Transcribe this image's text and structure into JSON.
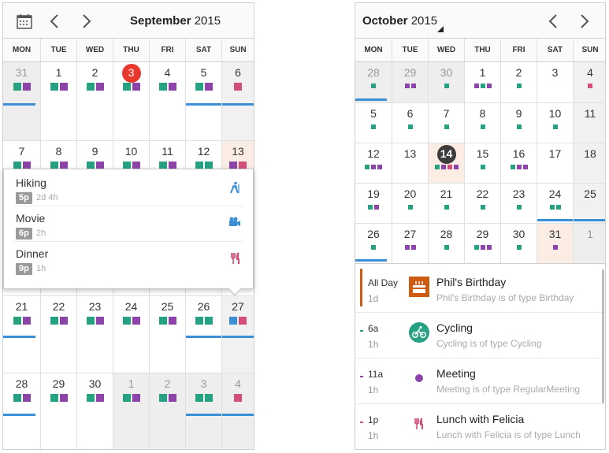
{
  "colors": {
    "teal": "#26a182",
    "purple": "#8c44a8",
    "pink": "#d14f78",
    "blue": "#3a8fd6",
    "red": "#e8372c",
    "orange": "#cf5b13"
  },
  "left": {
    "month": "September",
    "year": "2015",
    "weekdays": [
      "MON",
      "TUE",
      "WED",
      "THU",
      "FRI",
      "SAT",
      "SUN"
    ],
    "weeks": [
      [
        {
          "d": "31",
          "other": true,
          "dots": [
            "#26a182",
            "#8c44a8"
          ],
          "bar": true
        },
        {
          "d": "1",
          "dots": [
            "#26a182",
            "#8c44a8"
          ]
        },
        {
          "d": "2",
          "dots": [
            "#26a182",
            "#8c44a8"
          ]
        },
        {
          "d": "3",
          "today": true,
          "dots": [
            "#26a182",
            "#8c44a8"
          ]
        },
        {
          "d": "4",
          "dots": [
            "#26a182",
            "#8c44a8"
          ]
        },
        {
          "d": "5",
          "dots": [
            "#26a182",
            "#8c44a8"
          ],
          "bar": true
        },
        {
          "d": "6",
          "wknd": true,
          "dots": [
            "#d14f78"
          ],
          "bar": true
        }
      ],
      [
        {
          "d": "7",
          "dots": [
            "#26a182",
            "#8c44a8"
          ]
        },
        {
          "d": "8",
          "dots": [
            "#26a182",
            "#8c44a8"
          ]
        },
        {
          "d": "9",
          "dots": [
            "#26a182",
            "#8c44a8"
          ]
        },
        {
          "d": "10",
          "dots": [
            "#26a182",
            "#8c44a8"
          ]
        },
        {
          "d": "11",
          "dots": [
            "#26a182",
            "#8c44a8"
          ]
        },
        {
          "d": "12",
          "dots": [
            "#26a182",
            "#26a182"
          ]
        },
        {
          "d": "13",
          "hl": true,
          "dots": [
            "#8c44a8",
            "#d14f78"
          ]
        }
      ],
      [
        {
          "d": ""
        },
        {
          "d": ""
        },
        {
          "d": ""
        },
        {
          "d": ""
        },
        {
          "d": ""
        },
        {
          "d": ""
        },
        {
          "d": ""
        }
      ],
      [
        {
          "d": "21",
          "dots": [
            "#26a182",
            "#8c44a8"
          ],
          "bar": true
        },
        {
          "d": "22",
          "dots": [
            "#26a182",
            "#8c44a8"
          ]
        },
        {
          "d": "23",
          "dots": [
            "#26a182",
            "#8c44a8"
          ]
        },
        {
          "d": "24",
          "dots": [
            "#26a182",
            "#8c44a8"
          ]
        },
        {
          "d": "25",
          "dots": [
            "#26a182",
            "#8c44a8"
          ]
        },
        {
          "d": "26",
          "dots": [
            "#26a182",
            "#26a182"
          ],
          "bar": true
        },
        {
          "d": "27",
          "wknd": true,
          "dots": [
            "#3a8fd6",
            "#d14f78"
          ],
          "bar": true
        }
      ],
      [
        {
          "d": "28",
          "dots": [
            "#26a182",
            "#8c44a8"
          ],
          "bar": true
        },
        {
          "d": "29",
          "dots": [
            "#26a182",
            "#8c44a8"
          ]
        },
        {
          "d": "30",
          "dots": [
            "#26a182",
            "#8c44a8"
          ]
        },
        {
          "d": "1",
          "other": true,
          "dots": [
            "#26a182",
            "#8c44a8"
          ]
        },
        {
          "d": "2",
          "other": true,
          "dots": [
            "#26a182",
            "#8c44a8"
          ]
        },
        {
          "d": "3",
          "other": true,
          "dots": [
            "#26a182",
            "#26a182"
          ],
          "bar": true
        },
        {
          "d": "4",
          "other": true,
          "dots": [
            "#d14f78"
          ],
          "bar": true
        }
      ]
    ],
    "popup": [
      {
        "title": "Hiking",
        "time": "5p",
        "duration": "2d 4h",
        "icon": "hiking-icon",
        "color": "#3a8fd6"
      },
      {
        "title": "Movie",
        "time": "6p",
        "duration": "2h",
        "icon": "video-camera-icon",
        "color": "#3a8fd6"
      },
      {
        "title": "Dinner",
        "time": "9p",
        "duration": "1h",
        "icon": "fork-knife-icon",
        "color": "#d14f78"
      }
    ]
  },
  "right": {
    "month": "October",
    "year": "2015",
    "weekdays": [
      "MON",
      "TUE",
      "WED",
      "THU",
      "FRI",
      "SAT",
      "SUN"
    ],
    "weeks": [
      [
        {
          "d": "28",
          "other": true,
          "dots": [
            "#26a182"
          ],
          "bar": true
        },
        {
          "d": "29",
          "other": true,
          "dots": [
            "#8c44a8",
            "#8c44a8"
          ]
        },
        {
          "d": "30",
          "other": true,
          "dots": [
            "#26a182"
          ]
        },
        {
          "d": "1",
          "dots": [
            "#8c44a8",
            "#26a182",
            "#8c44a8"
          ]
        },
        {
          "d": "2",
          "dots": [
            "#26a182"
          ]
        },
        {
          "d": "3",
          "dots": []
        },
        {
          "d": "4",
          "wknd": true,
          "dots": [
            "#d14f78"
          ]
        }
      ],
      [
        {
          "d": "5",
          "dots": [
            "#26a182"
          ]
        },
        {
          "d": "6",
          "dots": [
            "#26a182"
          ]
        },
        {
          "d": "7",
          "dots": [
            "#26a182"
          ]
        },
        {
          "d": "8",
          "dots": [
            "#26a182"
          ]
        },
        {
          "d": "9",
          "dots": [
            "#26a182"
          ]
        },
        {
          "d": "10",
          "dots": [
            "#26a182"
          ]
        },
        {
          "d": "11",
          "wknd": true,
          "dots": []
        }
      ],
      [
        {
          "d": "12",
          "dots": [
            "#26a182",
            "#8c44a8",
            "#8c44a8"
          ]
        },
        {
          "d": "13",
          "dots": []
        },
        {
          "d": "14",
          "today": true,
          "hl": true,
          "dots": [
            "#26a182",
            "#8c44a8",
            "#d14f78",
            "#8c44a8"
          ]
        },
        {
          "d": "15",
          "dots": [
            "#26a182"
          ]
        },
        {
          "d": "16",
          "dots": [
            "#26a182",
            "#8c44a8",
            "#8c44a8"
          ]
        },
        {
          "d": "17",
          "dots": []
        },
        {
          "d": "18",
          "wknd": true,
          "dots": []
        }
      ],
      [
        {
          "d": "19",
          "dots": [
            "#26a182",
            "#8c44a8"
          ]
        },
        {
          "d": "20",
          "dots": [
            "#26a182"
          ]
        },
        {
          "d": "21",
          "dots": [
            "#26a182"
          ]
        },
        {
          "d": "22",
          "dots": [
            "#26a182"
          ]
        },
        {
          "d": "23",
          "dots": [
            "#26a182"
          ]
        },
        {
          "d": "24",
          "dots": [
            "#26a182",
            "#26a182"
          ],
          "bar": true
        },
        {
          "d": "25",
          "wknd": true,
          "dots": [],
          "bar": true
        }
      ],
      [
        {
          "d": "26",
          "dots": [
            "#26a182"
          ],
          "bar": true
        },
        {
          "d": "27",
          "dots": [
            "#8c44a8",
            "#8c44a8"
          ]
        },
        {
          "d": "28",
          "dots": [
            "#26a182"
          ]
        },
        {
          "d": "29",
          "dots": [
            "#26a182",
            "#8c44a8",
            "#8c44a8"
          ]
        },
        {
          "d": "30",
          "dots": [
            "#26a182"
          ]
        },
        {
          "d": "31",
          "hl": true,
          "dots": [
            "#8c44a8"
          ]
        },
        {
          "d": "1",
          "other": true,
          "dots": []
        }
      ]
    ],
    "agenda": [
      {
        "time": "All Day",
        "duration": "1d",
        "title": "Phil's Birthday",
        "desc": "Phil's Birthday is of type Birthday",
        "icon": "cake-icon",
        "color": "#cf5b13"
      },
      {
        "time": "6a",
        "duration": "1h",
        "title": "Cycling",
        "desc": "Cycling is of type Cycling",
        "icon": "bicycle-icon",
        "color": "#26a182"
      },
      {
        "time": "11a",
        "duration": "1h",
        "title": "Meeting",
        "desc": "Meeting is of type RegularMeeting",
        "icon": "dot-icon",
        "color": "#8c44a8"
      },
      {
        "time": "1p",
        "duration": "1h",
        "title": "Lunch with Felicia",
        "desc": "Lunch with Felicia is of type Lunch",
        "icon": "fork-knife-icon",
        "color": "#d14f78"
      }
    ]
  }
}
